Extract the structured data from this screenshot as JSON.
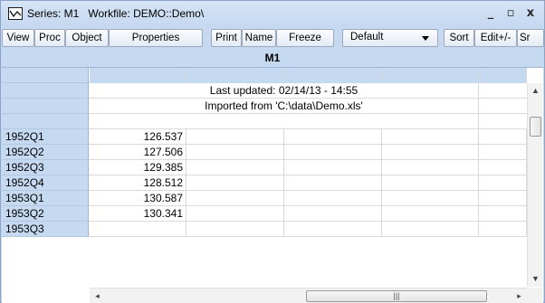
{
  "window": {
    "title": "Series: M1   Workfile: DEMO::Demo\\",
    "minimize": "_",
    "maximize": "▫",
    "close": "x"
  },
  "toolbar": {
    "buttons": [
      "View",
      "Proc",
      "Object",
      "Properties",
      "Print",
      "Name",
      "Freeze",
      "Sort",
      "Edit+/-",
      "Sr"
    ],
    "display_select": "Default"
  },
  "grid": {
    "series_name": "M1",
    "notes": [
      "Last updated: 02/14/13 - 14:55",
      "Imported from 'C:\\data\\Demo.xls'"
    ],
    "rows": [
      {
        "label": "1952Q1",
        "value": "126.537"
      },
      {
        "label": "1952Q2",
        "value": "127.506"
      },
      {
        "label": "1952Q3",
        "value": "129.385"
      },
      {
        "label": "1952Q4",
        "value": "128.512"
      },
      {
        "label": "1953Q1",
        "value": "130.587"
      },
      {
        "label": "1953Q2",
        "value": "130.341"
      },
      {
        "label": "1953Q3",
        "value": ""
      }
    ]
  },
  "scrollbar": {
    "up": "▲",
    "down": "▼",
    "left": "◂",
    "right": "▸",
    "grip": "|||"
  }
}
